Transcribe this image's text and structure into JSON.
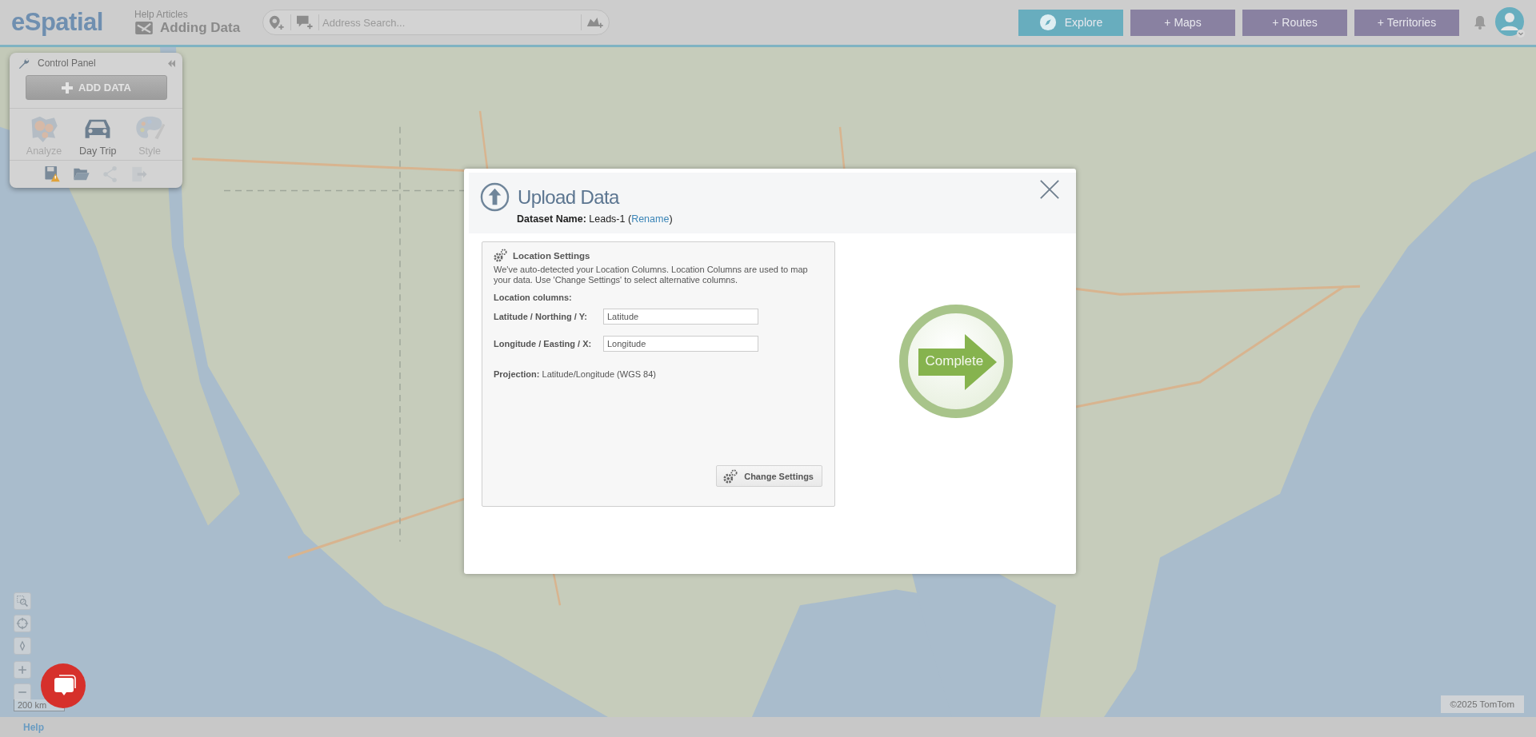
{
  "header": {
    "logo": "eSpatial",
    "help_label": "Help Articles",
    "help_title": "Adding Data",
    "search": {
      "placeholder": "Address Search..."
    },
    "nav_buttons": [
      {
        "label": "Explore",
        "selected": true,
        "kind": "explore"
      },
      {
        "label": "+ Maps",
        "selected": false,
        "kind": "plain"
      },
      {
        "label": "+ Routes",
        "selected": false,
        "kind": "plain"
      },
      {
        "label": "+ Territories",
        "selected": false,
        "kind": "plain"
      }
    ]
  },
  "control_panel": {
    "title": "Control Panel",
    "add_button": "ADD DATA",
    "tools": [
      {
        "kind": "analyze",
        "label": "Analyze",
        "disabled": true
      },
      {
        "kind": "car",
        "label": "Day Trip",
        "disabled": false
      },
      {
        "kind": "palette",
        "label": "Style",
        "disabled": true
      }
    ],
    "actions": [
      {
        "kind": "save-warning",
        "disabled": false
      },
      {
        "kind": "folder",
        "disabled": false
      },
      {
        "kind": "share",
        "disabled": true
      },
      {
        "kind": "export",
        "disabled": true
      }
    ]
  },
  "map": {
    "controls": [
      {
        "kind": "zoom-box"
      },
      {
        "kind": "locate"
      },
      {
        "kind": "compass"
      },
      {
        "kind": "zoom-in"
      },
      {
        "kind": "zoom-out"
      }
    ],
    "scale": "200 km",
    "attribution": "©2025 TomTom"
  },
  "dialog": {
    "title": "Upload Data",
    "dataset_text": "**Dataset Name:** Leads-1 (",
    "rename_link": "Rename",
    "dataset_after": ")",
    "location": {
      "title": "Location Settings",
      "description": "We've auto-detected your Location Columns. Location Columns are used to map your data. Use 'Change Settings' to select alternative columns.",
      "columns_label": "Location columns:",
      "fields": [
        {
          "label": "Latitude / Northing / Y:",
          "value": "Latitude"
        },
        {
          "label": "Longitude / Easting / X:",
          "value": "Longitude"
        }
      ],
      "projection": "**Projection:** Latitude/Longitude (WGS 84)",
      "change_button": "Change Settings"
    },
    "complete_button": "Complete"
  },
  "footer": {
    "help_link": "Help"
  }
}
